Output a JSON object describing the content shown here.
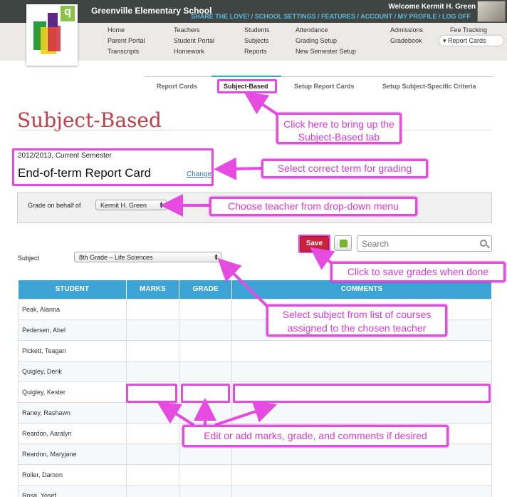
{
  "header": {
    "school_name": "Greenville Elementary School",
    "welcome": "Welcome Kermit H. Green",
    "top_links": [
      "SHARE THE LOVE!",
      "SCHOOL SETTINGS",
      "FEATURES",
      "ACCOUNT",
      "MY PROFILE",
      "LOG OFF"
    ],
    "separator": " / "
  },
  "nav": {
    "col1": [
      "Home",
      "Parent Portal",
      "Transcripts"
    ],
    "col2": [
      "Teachers",
      "Student Portal",
      "Homework"
    ],
    "col3": [
      "Students",
      "Subjects",
      "Reports"
    ],
    "col4": [
      "Attendance",
      "Grading Setup",
      "New Semester Setup"
    ],
    "col5": [
      "Admissions",
      "Gradebook"
    ],
    "col6": [
      "Fee Tracking",
      "Report Cards"
    ]
  },
  "tabs": [
    "Report Cards",
    "Subject-Based",
    "Setup Report Cards",
    "Setup Subject-Specific Criteria"
  ],
  "page_title": "Subject-Based",
  "term": {
    "semester": "2012/2013, Current Semester",
    "name": "End-of-term Report Card",
    "change_link": "Change"
  },
  "grade_on_behalf": {
    "label": "Grade on behalf of",
    "selected": "Kermit H. Green"
  },
  "toolbar": {
    "save_label": "Save",
    "search_placeholder": "Search"
  },
  "subject": {
    "label": "Subject",
    "selected": "8th Grade – Life Sciences"
  },
  "table": {
    "headers": [
      "STUDENT",
      "MARKS",
      "GRADE",
      "COMMENTS"
    ],
    "rows": [
      "Peak, Alanna",
      "Pedersen, Abel",
      "Pickett, Teagan",
      "Quigley, Derik",
      "Quigley, Kester",
      "Raney, Rashawn",
      "Reardon, Aaralyn",
      "Reardon, Maryjane",
      "Roller, Damon",
      "Rosa, Yosef"
    ]
  },
  "callouts": {
    "tab": "Click here to bring up the Subject-Based tab",
    "term": "Select correct term for grading",
    "teacher": "Choose teacher from drop-down menu",
    "save": "Click to save grades when done",
    "subject": "Select subject from list of courses assigned to the chosen teacher",
    "edit": "Edit or add marks, grade, and comments if desired"
  },
  "colors": {
    "header_bg": "#3f4542",
    "link_blue": "#5fb8d8",
    "title_red": "#c33e48",
    "table_header": "#3ba3d6",
    "save_red": "#c8233a",
    "annotation_magenta": "#e54be0"
  }
}
